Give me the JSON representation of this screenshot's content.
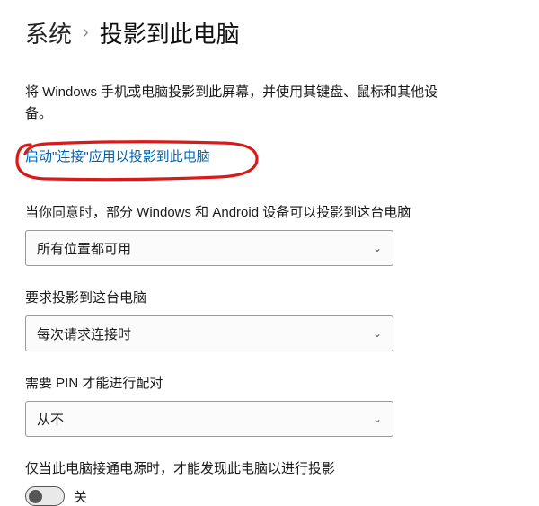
{
  "breadcrumb": {
    "parent": "系统",
    "current": "投影到此电脑"
  },
  "description": "将 Windows 手机或电脑投影到此屏幕，并使用其键盘、鼠标和其他设备。",
  "link": {
    "label": "启动\"连接\"应用以投影到此电脑"
  },
  "fields": {
    "who_can_project": {
      "label": "当你同意时，部分 Windows 和 Android 设备可以投影到这台电脑",
      "value": "所有位置都可用"
    },
    "ask_to_project": {
      "label": "要求投影到这台电脑",
      "value": "每次请求连接时"
    },
    "require_pin": {
      "label": "需要 PIN 才能进行配对",
      "value": "从不"
    },
    "power_only": {
      "label": "仅当此电脑接通电源时，才能发现此电脑以进行投影",
      "state_label": "关"
    }
  }
}
